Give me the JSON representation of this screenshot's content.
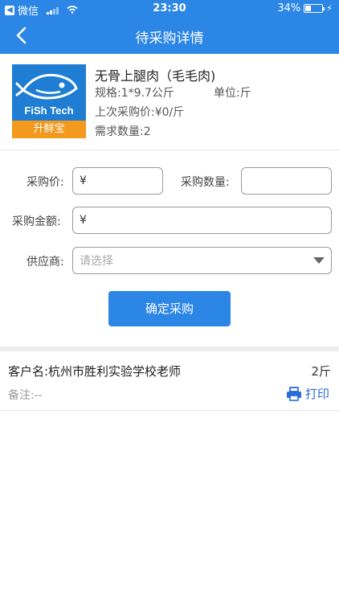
{
  "status_bar": {
    "back_app": "微信",
    "time": "23:30",
    "battery_text": "34%",
    "battery_level": 0.34
  },
  "nav": {
    "title": "待采购详情"
  },
  "product": {
    "logo_brand": "FiSh Tech",
    "logo_tagline": "升鲜宝",
    "name": "无骨上腿肉（毛毛肉)",
    "spec": "规格:1*9.7公斤",
    "unit": "单位:斤",
    "last_price": "上次采购价:¥0/斤",
    "demand_qty": "需求数量:2"
  },
  "form": {
    "price_label": "采购价:",
    "price_value": "¥",
    "qty_label": "采购数量:",
    "qty_value": "",
    "amount_label": "采购金额:",
    "amount_value": "¥",
    "supplier_label": "供应商:",
    "supplier_placeholder": "请选择",
    "confirm_label": "确定采购"
  },
  "order": {
    "customer": "客户名:杭州市胜利实验学校老师",
    "qty": "2斤",
    "remark": "备注:--",
    "print_label": "打印"
  },
  "colors": {
    "primary": "#2b86e6",
    "logo_blue": "#1f7dd4",
    "logo_orange": "#f39a1e",
    "link": "#2b6bd8"
  }
}
